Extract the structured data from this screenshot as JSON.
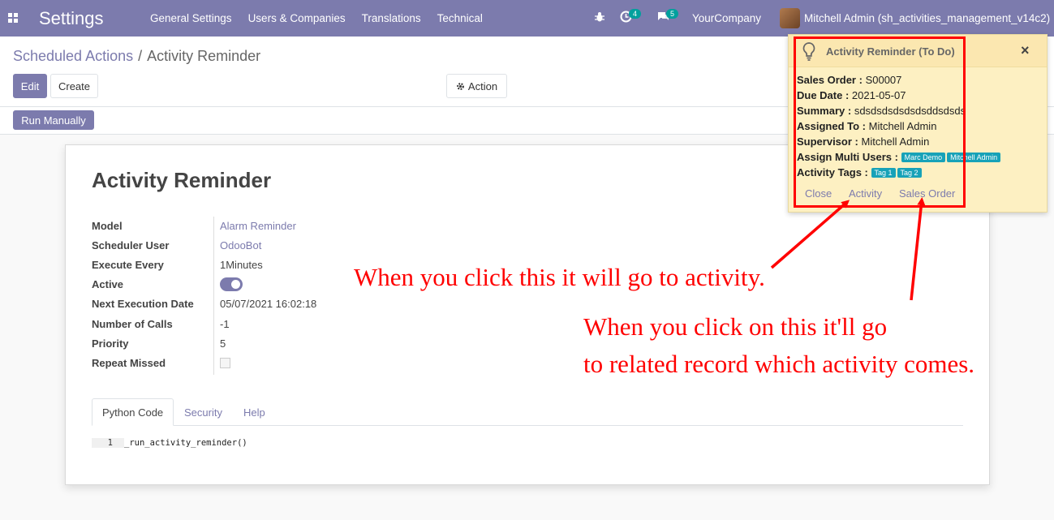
{
  "navbar": {
    "brand": "Settings",
    "menu": [
      "General Settings",
      "Users & Companies",
      "Translations",
      "Technical"
    ],
    "activity_count": "4",
    "message_count": "5",
    "company": "YourCompany",
    "user": "Mitchell Admin (sh_activities_management_v14c2)",
    "color": "#7c7bad"
  },
  "breadcrumb": {
    "parent": "Scheduled Actions",
    "separator": "/",
    "current": "Activity Reminder"
  },
  "toolbar": {
    "edit_label": "Edit",
    "create_label": "Create",
    "action_label": "Action",
    "run_manually_label": "Run Manually"
  },
  "record": {
    "title": "Activity Reminder",
    "fields": [
      {
        "label": "Model",
        "value": "Alarm Reminder"
      },
      {
        "label": "Scheduler User",
        "value": "OdooBot"
      },
      {
        "label": "Execute Every",
        "value": "1Minutes"
      },
      {
        "label": "Active",
        "value": ""
      },
      {
        "label": "Next Execution Date",
        "value": "05/07/2021 16:02:18"
      },
      {
        "label": "Number of Calls",
        "value": "-1"
      },
      {
        "label": "Priority",
        "value": "5"
      },
      {
        "label": "Repeat Missed",
        "value": ""
      }
    ],
    "active": true,
    "repeat_missed": false
  },
  "tabs": [
    "Python Code",
    "Security",
    "Help"
  ],
  "code": {
    "line_number": "1",
    "line": "_run_activity_reminder()"
  },
  "popup": {
    "title": "Activity Reminder (To Do)",
    "close_symbol": "×",
    "sales_order_label": "Sales Order :",
    "sales_order": "S00007",
    "due_date_label": "Due Date :",
    "due_date": "2021-05-07",
    "summary_label": "Summary :",
    "summary": "sdsdsdsdsdsdsddsdsds",
    "assigned_label": "Assigned To :",
    "assigned": "Mitchell Admin",
    "supervisor_label": "Supervisor :",
    "supervisor": "Mitchell Admin",
    "multi_users_label": "Assign Multi Users :",
    "multi_users": [
      "Marc Demo",
      "Mitchell Admin"
    ],
    "tags_label": "Activity Tags :",
    "tags": [
      "Tag 1",
      "Tag 2"
    ],
    "actions": [
      "Close",
      "Activity",
      "Sales Order"
    ]
  },
  "annotations": {
    "activity_note": "When you click this it will go to activity.",
    "record_note_1": "When you click on this it'll go",
    "record_note_2": "to related record which activity comes.",
    "color": "#ff0000"
  }
}
